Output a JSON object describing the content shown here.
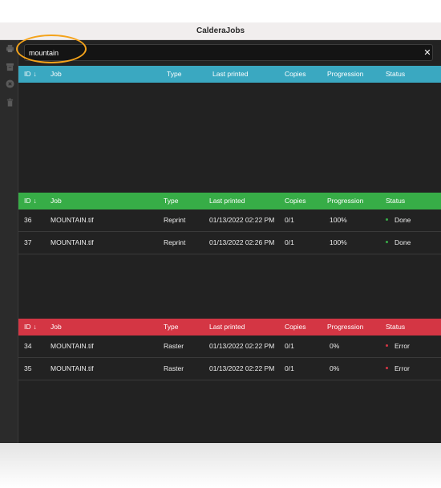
{
  "app": {
    "title": "CalderaJobs"
  },
  "sidebar": {
    "icons": [
      {
        "name": "printer-icon"
      },
      {
        "name": "archive-icon"
      },
      {
        "name": "cancel-circle-icon"
      },
      {
        "name": "trash-icon"
      }
    ]
  },
  "search": {
    "value": "mountain",
    "clear_label": "✕"
  },
  "columns": {
    "id": "ID",
    "sort_arrow": "↓",
    "job": "Job",
    "type": "Type",
    "last_printed": "Last printed",
    "copies": "Copies",
    "progression": "Progression",
    "status": "Status"
  },
  "sections": [
    {
      "name": "queue",
      "color": "#3aa8c1",
      "rows": []
    },
    {
      "name": "printed",
      "color": "#37ad47",
      "status_dot": "#37ad47",
      "rows": [
        {
          "id": "36",
          "job": "MOUNTAIN.tif",
          "type": "Reprint",
          "last_printed": "01/13/2022 02:22 PM",
          "copies": "0/1",
          "progression": "100%",
          "status": "Done"
        },
        {
          "id": "37",
          "job": "MOUNTAIN.tif",
          "type": "Reprint",
          "last_printed": "01/13/2022 02:26 PM",
          "copies": "0/1",
          "progression": "100%",
          "status": "Done"
        }
      ]
    },
    {
      "name": "errors",
      "color": "#d43644",
      "status_dot": "#d43644",
      "rows": [
        {
          "id": "34",
          "job": "MOUNTAIN.tif",
          "type": "Raster",
          "last_printed": "01/13/2022 02:22 PM",
          "copies": "0/1",
          "progression": "0%",
          "status": "Error"
        },
        {
          "id": "35",
          "job": "MOUNTAIN.tif",
          "type": "Raster",
          "last_printed": "01/13/2022 02:22 PM",
          "copies": "0/1",
          "progression": "0%",
          "status": "Error"
        }
      ]
    }
  ]
}
